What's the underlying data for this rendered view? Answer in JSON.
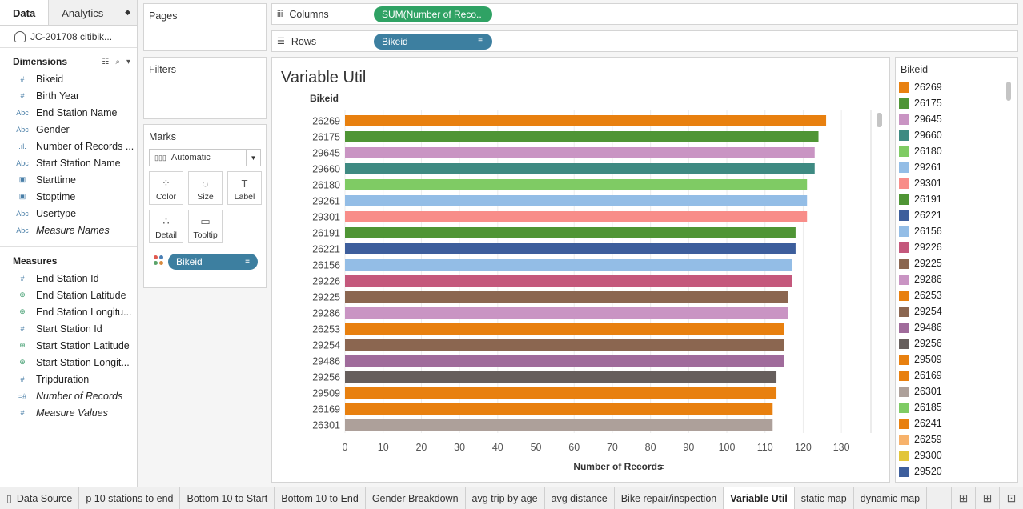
{
  "data_pane": {
    "tabs": [
      "Data",
      "Analytics"
    ],
    "datasource": "JC-201708 citibik...",
    "dimensions_label": "Dimensions",
    "dimensions": [
      {
        "icon": "#",
        "name": "Bikeid",
        "italic": false
      },
      {
        "icon": "#",
        "name": "Birth Year",
        "italic": false
      },
      {
        "icon": "Abc",
        "name": "End Station Name",
        "italic": false
      },
      {
        "icon": "Abc",
        "name": "Gender",
        "italic": false
      },
      {
        "icon": ".ıl.",
        "name": "Number of Records ...",
        "italic": false
      },
      {
        "icon": "Abc",
        "name": "Start Station Name",
        "italic": false
      },
      {
        "icon": "▣",
        "name": "Starttime",
        "italic": false
      },
      {
        "icon": "▣",
        "name": "Stoptime",
        "italic": false
      },
      {
        "icon": "Abc",
        "name": "Usertype",
        "italic": false
      },
      {
        "icon": "Abc",
        "name": "Measure Names",
        "italic": true
      }
    ],
    "measures_label": "Measures",
    "measures": [
      {
        "icon": "#",
        "name": "End Station Id",
        "italic": false
      },
      {
        "icon": "⊕",
        "name": "End Station Latitude",
        "italic": false
      },
      {
        "icon": "⊕",
        "name": "End Station Longitu...",
        "italic": false
      },
      {
        "icon": "#",
        "name": "Start Station Id",
        "italic": false
      },
      {
        "icon": "⊕",
        "name": "Start Station Latitude",
        "italic": false
      },
      {
        "icon": "⊕",
        "name": "Start Station Longit...",
        "italic": false
      },
      {
        "icon": "#",
        "name": "Tripduration",
        "italic": false
      },
      {
        "icon": "=#",
        "name": "Number of Records",
        "italic": true
      },
      {
        "icon": "#",
        "name": "Measure Values",
        "italic": true
      }
    ]
  },
  "cards": {
    "pages": "Pages",
    "filters": "Filters",
    "marks": "Marks",
    "mark_type": "Automatic",
    "mark_buttons": [
      {
        "icon": "⁘",
        "label": "Color"
      },
      {
        "icon": "◌",
        "label": "Size"
      },
      {
        "icon": "T",
        "label": "Label"
      },
      {
        "icon": "∴",
        "label": "Detail"
      },
      {
        "icon": "▭",
        "label": "Tooltip"
      }
    ],
    "color_pill": "Bikeid"
  },
  "shelves": {
    "columns_label": "Columns",
    "columns_pill": "SUM(Number of Reco..",
    "rows_label": "Rows",
    "rows_pill": "Bikeid"
  },
  "chart_data": {
    "type": "bar",
    "orientation": "horizontal",
    "title": "Variable Util",
    "xlabel": "Number of Records",
    "ylabel": "Bikeid",
    "xlim": [
      0,
      135
    ],
    "xticks": [
      0,
      10,
      20,
      30,
      40,
      50,
      60,
      70,
      80,
      90,
      100,
      110,
      120,
      130
    ],
    "grid": true,
    "categories": [
      "26269",
      "26175",
      "29645",
      "29660",
      "26180",
      "29261",
      "29301",
      "26191",
      "26221",
      "26156",
      "29226",
      "29225",
      "29286",
      "26253",
      "29254",
      "29486",
      "29256",
      "29509",
      "26169",
      "26301"
    ],
    "values": [
      126,
      124,
      123,
      123,
      121,
      121,
      121,
      118,
      118,
      117,
      117,
      116,
      116,
      115,
      115,
      115,
      113,
      113,
      112,
      112
    ],
    "colors": [
      "#e8800f",
      "#4f9535",
      "#c994c3",
      "#3e8a82",
      "#7fcb64",
      "#93bde6",
      "#f88d89",
      "#4f9535",
      "#3d5e9c",
      "#93bde6",
      "#c4587c",
      "#8b6650",
      "#c994c3",
      "#e8800f",
      "#8b6650",
      "#a06b9b",
      "#665e5c",
      "#e8800f",
      "#e8800f",
      "#ada09a"
    ]
  },
  "legend": {
    "title": "Bikeid",
    "items": [
      {
        "label": "26269",
        "color": "#e8800f"
      },
      {
        "label": "26175",
        "color": "#4f9535"
      },
      {
        "label": "29645",
        "color": "#c994c3"
      },
      {
        "label": "29660",
        "color": "#3e8a82"
      },
      {
        "label": "26180",
        "color": "#7fcb64"
      },
      {
        "label": "29261",
        "color": "#93bde6"
      },
      {
        "label": "29301",
        "color": "#f88d89"
      },
      {
        "label": "26191",
        "color": "#4f9535"
      },
      {
        "label": "26221",
        "color": "#3d5e9c"
      },
      {
        "label": "26156",
        "color": "#93bde6"
      },
      {
        "label": "29226",
        "color": "#c4587c"
      },
      {
        "label": "29225",
        "color": "#8b6650"
      },
      {
        "label": "29286",
        "color": "#c994c3"
      },
      {
        "label": "26253",
        "color": "#e8800f"
      },
      {
        "label": "29254",
        "color": "#8b6650"
      },
      {
        "label": "29486",
        "color": "#a06b9b"
      },
      {
        "label": "29256",
        "color": "#665e5c"
      },
      {
        "label": "29509",
        "color": "#e8800f"
      },
      {
        "label": "26169",
        "color": "#e8800f"
      },
      {
        "label": "26301",
        "color": "#ada09a"
      },
      {
        "label": "26185",
        "color": "#7fcb64"
      },
      {
        "label": "26241",
        "color": "#e8800f"
      },
      {
        "label": "26259",
        "color": "#f7b26b"
      },
      {
        "label": "29300",
        "color": "#e2c53b"
      },
      {
        "label": "29520",
        "color": "#3d5e9c"
      }
    ]
  },
  "sheet_tabs": {
    "items": [
      {
        "label": "Data Source",
        "active": false
      },
      {
        "label": "p 10 stations to end",
        "active": false
      },
      {
        "label": "Bottom 10 to Start",
        "active": false
      },
      {
        "label": "Bottom 10 to End",
        "active": false
      },
      {
        "label": "Gender Breakdown",
        "active": false
      },
      {
        "label": "avg trip by age",
        "active": false
      },
      {
        "label": "avg distance",
        "active": false
      },
      {
        "label": "Bike repair/inspection",
        "active": false
      },
      {
        "label": "Variable Util",
        "active": true
      },
      {
        "label": "static map",
        "active": false
      },
      {
        "label": "dynamic map",
        "active": false
      }
    ]
  }
}
